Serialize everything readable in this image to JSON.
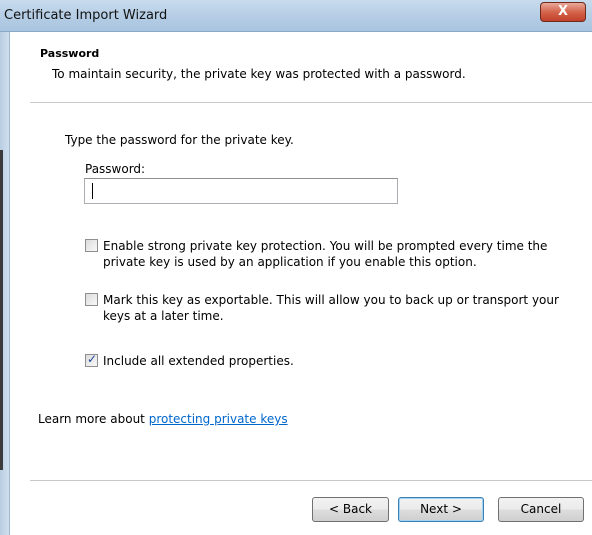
{
  "window": {
    "title": "Certificate Import Wizard",
    "close_glyph": "X"
  },
  "header": {
    "title": "Password",
    "subtitle": "To maintain security, the private key was protected with a password."
  },
  "body": {
    "instruction": "Type the password for the private key.",
    "password_label": "Password:",
    "password_value": "",
    "options": [
      {
        "label": "Enable strong private key protection. You will be prompted every time the private key is used by an application if you enable this option.",
        "checked": false
      },
      {
        "label": "Mark this key as exportable. This will allow you to back up or transport your keys at a later time.",
        "checked": false
      },
      {
        "label": "Include all extended properties.",
        "checked": true
      }
    ]
  },
  "learn_more": {
    "prefix": "Learn more about ",
    "link_text": "protecting private keys"
  },
  "buttons": {
    "back": "< Back",
    "next": "Next >",
    "cancel": "Cancel"
  },
  "colors": {
    "link": "#0066cc",
    "titlebar": "#b7cfe6",
    "close": "#d4644c"
  }
}
